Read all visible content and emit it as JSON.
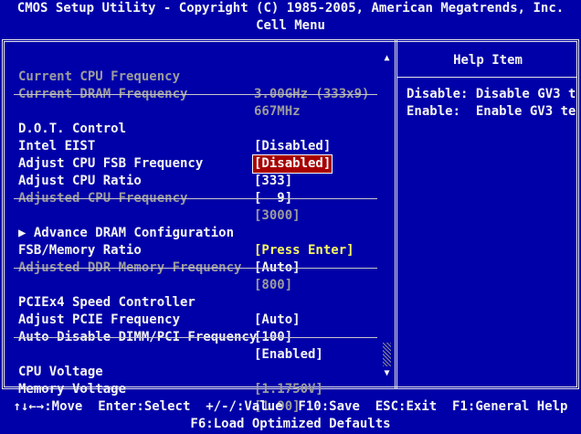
{
  "header": {
    "title": "CMOS Setup Utility - Copyright (C) 1985-2005, American Megatrends, Inc.",
    "menu": "Cell Menu"
  },
  "settings": [
    {
      "label": "Current CPU Frequency",
      "value": "3.00GHz (333x9)",
      "state": "dim"
    },
    {
      "label": "Current DRAM Frequency",
      "value": "667MHz",
      "state": "dim"
    },
    {
      "label": "D.O.T. Control",
      "value": "[Disabled]",
      "state": "normal"
    },
    {
      "label": "Intel EIST",
      "value": "[Disabled]",
      "state": "selected"
    },
    {
      "label": "Adjust CPU FSB Frequency",
      "value": "[333]",
      "state": "normal"
    },
    {
      "label": "Adjust CPU Ratio",
      "value": "[  9]",
      "state": "normal"
    },
    {
      "label": "Adjusted CPU Frequency",
      "value": "[3000]",
      "state": "dim"
    },
    {
      "label": "▶ Advance DRAM Configuration",
      "value": "[Press Enter]",
      "state": "submenu"
    },
    {
      "label": "FSB/Memory Ratio",
      "value": "[Auto]",
      "state": "normal"
    },
    {
      "label": "Adjusted DDR Memory Frequency",
      "value": "[800]",
      "state": "dim"
    },
    {
      "label": "PCIEx4 Speed Controller",
      "value": "[Auto]",
      "state": "normal"
    },
    {
      "label": "Adjust PCIE Frequency",
      "value": "[100]",
      "state": "normal"
    },
    {
      "label": "Auto Disable DIMM/PCI Frequency",
      "value": "[Enabled]",
      "state": "normal"
    },
    {
      "label": "CPU Voltage",
      "value": "[1.1750V]",
      "state": "dim"
    },
    {
      "label": "Memory Voltage",
      "value": "[1.90]",
      "state": "dim"
    }
  ],
  "help": {
    "title": "Help Item",
    "lines": [
      "Disable: Disable GV3 t",
      "Enable:  Enable GV3 te"
    ]
  },
  "footer": {
    "keys": [
      {
        "key": "↑↓←→",
        "action": "Move"
      },
      {
        "key": "Enter",
        "action": "Select"
      },
      {
        "key": "+/-/",
        "action": "Value"
      },
      {
        "key": "F10",
        "action": "Save"
      },
      {
        "key": "ESC",
        "action": "Exit"
      },
      {
        "key": "F1",
        "action": "General Help"
      }
    ],
    "line2": "F6:Load Optimized Defaults"
  },
  "scrollbar": {
    "up_icon": "▲",
    "down_icon": "▼",
    "visible_fraction": 0.92
  },
  "colors": {
    "background": "#0000a8",
    "text": "#f4f4f4",
    "dim_text": "#9c9c9c",
    "highlight": "#a80000",
    "submenu_value": "#f8f860"
  }
}
